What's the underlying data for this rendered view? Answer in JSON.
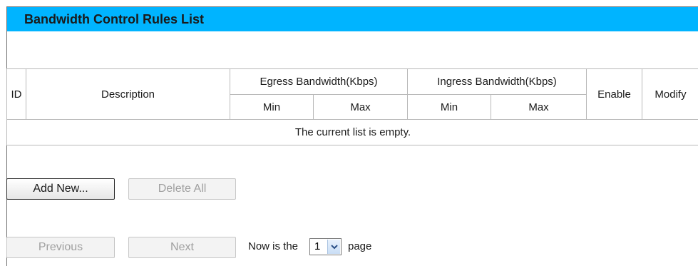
{
  "header": {
    "title": "Bandwidth Control Rules List"
  },
  "table": {
    "col_id": "ID",
    "col_description": "Description",
    "col_egress": "Egress Bandwidth(Kbps)",
    "col_ingress": "Ingress Bandwidth(Kbps)",
    "col_enable": "Enable",
    "col_modify": "Modify",
    "egress_min": "Min",
    "egress_max": "Max",
    "ingress_min": "Min",
    "ingress_max": "Max",
    "empty_message": "The current list is empty."
  },
  "actions": {
    "add_new": "Add New...",
    "delete_all": "Delete All"
  },
  "pager": {
    "previous": "Previous",
    "next": "Next",
    "prefix": "Now is the",
    "current_page": "1",
    "suffix": "page"
  },
  "icons": {
    "select_arrow": "chevron-down-icon"
  },
  "colors": {
    "title_bar": "#00b4ff",
    "border": "#b9b9b9",
    "disabled_text": "#a0a0a0"
  }
}
